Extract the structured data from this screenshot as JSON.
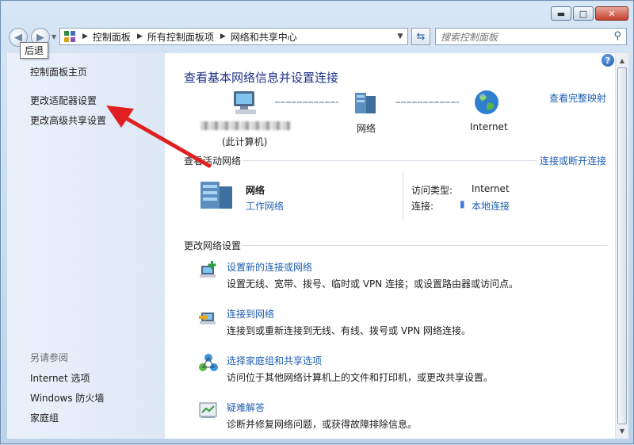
{
  "window": {
    "minimize": "▬",
    "maximize": "□",
    "close": "✕"
  },
  "nav": {
    "back_tooltip": "后退"
  },
  "address": {
    "crumbs": [
      "控制面板",
      "所有控制面板项",
      "网络和共享中心"
    ]
  },
  "search": {
    "placeholder": "搜索控制面板"
  },
  "sidebar": {
    "home": "控制面板主页",
    "items": [
      "更改适配器设置",
      "更改高级共享设置"
    ],
    "see_also_header": "另请参阅",
    "see_also": [
      "Internet 选项",
      "Windows 防火墙",
      "家庭组"
    ]
  },
  "main": {
    "title": "查看基本网络信息并设置连接",
    "view_full_map": "查看完整映射",
    "map": {
      "computer_caption": "(此计算机)",
      "network": "网络",
      "internet": "Internet"
    },
    "active": {
      "header": "查看活动网络",
      "connect_disconnect": "连接或断开连接",
      "name": "网络",
      "type": "工作网络",
      "access_label": "访问类型:",
      "access_value": "Internet",
      "conn_label": "连接:",
      "conn_value": "本地连接"
    },
    "change": {
      "header": "更改网络设置",
      "tasks": [
        {
          "title": "设置新的连接或网络",
          "desc": "设置无线、宽带、拨号、临时或 VPN 连接；或设置路由器或访问点。",
          "icon": "new-connection-icon"
        },
        {
          "title": "连接到网络",
          "desc": "连接到或重新连接到无线、有线、拨号或 VPN 网络连接。",
          "icon": "connect-network-icon"
        },
        {
          "title": "选择家庭组和共享选项",
          "desc": "访问位于其他网络计算机上的文件和打印机，或更改共享设置。",
          "icon": "homegroup-icon"
        },
        {
          "title": "疑难解答",
          "desc": "诊断并修复网络问题，或获得故障排除信息。",
          "icon": "troubleshoot-icon"
        }
      ]
    }
  },
  "colors": {
    "link": "#1f5fb3",
    "title": "#1e3287",
    "annotation_arrow": "#e02020"
  }
}
